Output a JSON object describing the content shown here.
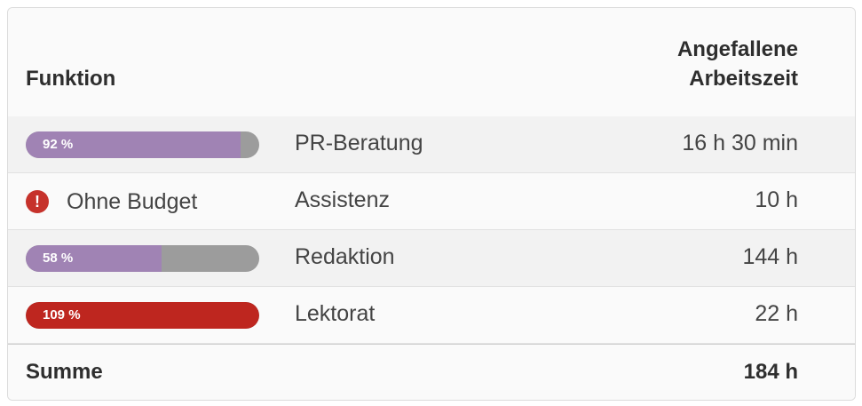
{
  "header": {
    "col_function": "Funktion",
    "col_time_line1": "Angefallene",
    "col_time_line2": "Arbeitszeit"
  },
  "rows": [
    {
      "budget_type": "bar",
      "budget_label": "92 %",
      "budget_percent": 92,
      "function": "PR-Beratung",
      "time": "16 h 30 min"
    },
    {
      "budget_type": "none",
      "budget_label": "Ohne Budget",
      "icon": "exclamation-circle-icon",
      "function": "Assistenz",
      "time": "10 h"
    },
    {
      "budget_type": "bar",
      "budget_label": "58 %",
      "budget_percent": 58,
      "function": "Redaktion",
      "time": "144 h"
    },
    {
      "budget_type": "bar",
      "budget_label": "109 %",
      "budget_percent": 109,
      "function": "Lektorat",
      "time": "22 h"
    }
  ],
  "footer": {
    "label": "Summe",
    "total": "184 h"
  },
  "colors": {
    "bar_normal": "#a083b4",
    "bar_over": "#be261f",
    "bar_track": "#9c9c9c",
    "warning": "#c6322b"
  }
}
